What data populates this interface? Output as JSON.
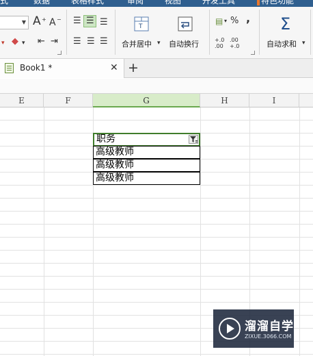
{
  "menu_tabs": [
    "式",
    "数据",
    "表格样式",
    "审阅",
    "视图",
    "开发工具",
    "特色功能"
  ],
  "ribbon": {
    "font_grow": "A",
    "font_shrink": "A",
    "merge_center_label": "合并居中",
    "wrap_text_label": "自动换行",
    "percent_symbol": "%",
    "comma_symbol": ",",
    "dec_increase": "+.0 .00",
    "dec_decrease": ".00 +.0",
    "sigma_symbol": "Σ",
    "autosum_label": "自动求和"
  },
  "document": {
    "tab_title": "Book1 *",
    "close_symbol": "✕",
    "new_tab_symbol": "+"
  },
  "columns": [
    "E",
    "F",
    "G",
    "H",
    "I"
  ],
  "selected_column": "G",
  "cells": {
    "header": "职务",
    "rows": [
      "高级教师",
      "高级教师",
      "高级教师"
    ]
  },
  "watermark": {
    "title": "溜溜自学",
    "subtitle": "ZIXUE.3066.COM"
  },
  "colors": {
    "accent_green": "#3f7d2b",
    "selected_header": "#d8ecc9"
  }
}
